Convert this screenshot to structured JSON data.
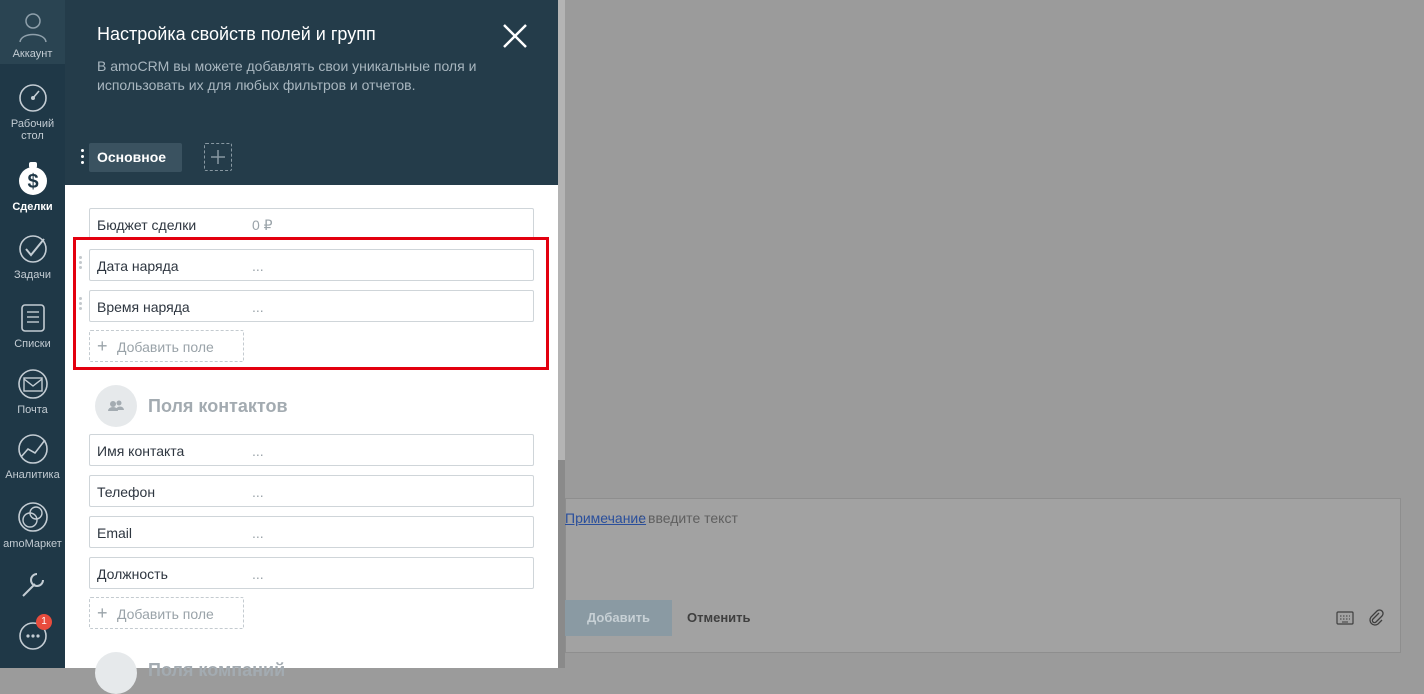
{
  "sidebar": {
    "items": [
      {
        "label": "Аккаунт",
        "icon": "account-icon"
      },
      {
        "label": "Рабочий стол",
        "icon": "dashboard-icon"
      },
      {
        "label": "Сделки",
        "icon": "deals-icon",
        "active": true
      },
      {
        "label": "Задачи",
        "icon": "tasks-icon"
      },
      {
        "label": "Списки",
        "icon": "lists-icon"
      },
      {
        "label": "Почта",
        "icon": "mail-icon"
      },
      {
        "label": "Аналитика",
        "icon": "analytics-icon"
      },
      {
        "label": "amoМаркет",
        "icon": "market-icon"
      },
      {
        "label": "",
        "icon": "settings-icon"
      }
    ],
    "chat_badge": "1"
  },
  "panel": {
    "title": "Настройка свойств полей и групп",
    "subtitle": "В amoCRM вы можете добавлять свои уникальные поля и использовать их для любых фильтров и отчетов.",
    "tab_label": "Основное",
    "budget": {
      "name": "Бюджет сделки",
      "value": "0 ₽"
    },
    "deal_fields": [
      {
        "name": "Дата наряда",
        "value": "..."
      },
      {
        "name": "Время наряда",
        "value": "..."
      }
    ],
    "add_field_label": "Добавить поле",
    "contacts_section": {
      "title": "Поля контактов",
      "fields": [
        {
          "name": "Имя контакта",
          "value": "..."
        },
        {
          "name": "Телефон",
          "value": "..."
        },
        {
          "name": "Email",
          "value": "..."
        },
        {
          "name": "Должность",
          "value": "..."
        }
      ]
    },
    "next_section_title": "Поля компаний"
  },
  "note": {
    "link": "Примечание",
    "colon": ":",
    "placeholder": "введите текст",
    "add_button": "Добавить",
    "cancel_button": "Отменить"
  },
  "colors": {
    "sidebar": "#1f3847",
    "panel_header": "#243c4a",
    "highlight": "#e3000f",
    "overlay": "#9b9b9b"
  }
}
